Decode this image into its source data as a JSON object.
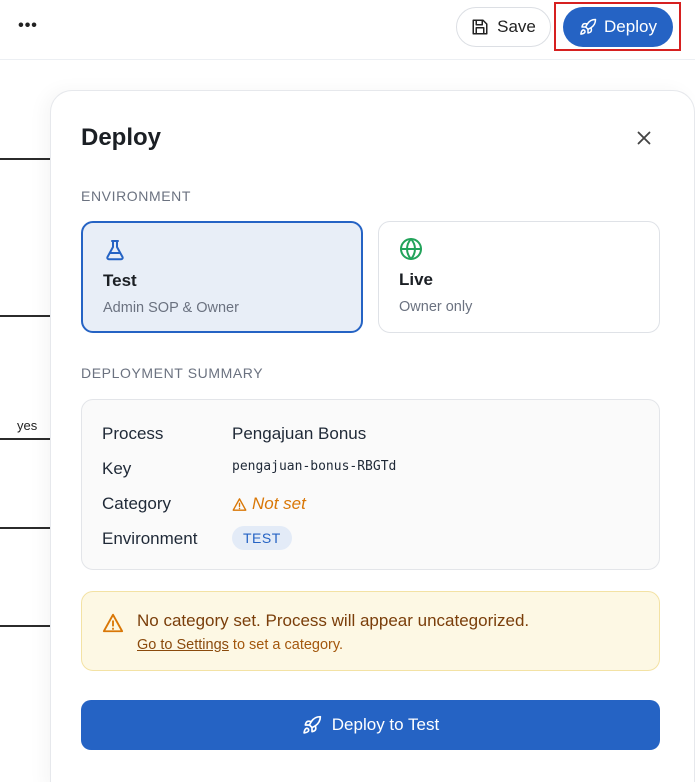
{
  "topbar": {
    "more_label": "•••",
    "save_label": "Save",
    "deploy_label": "Deploy"
  },
  "canvas": {
    "edge_label": "yes"
  },
  "panel": {
    "title": "Deploy",
    "environment_section": "ENVIRONMENT",
    "environments": [
      {
        "name": "Test",
        "description": "Admin SOP & Owner",
        "icon": "flask-icon",
        "selected": true
      },
      {
        "name": "Live",
        "description": "Owner only",
        "icon": "globe-icon",
        "selected": false
      }
    ],
    "summary_section": "DEPLOYMENT SUMMARY",
    "summary": {
      "process_label": "Process",
      "process_value": "Pengajuan Bonus",
      "key_label": "Key",
      "key_value": "pengajuan-bonus-RBGTd",
      "category_label": "Category",
      "category_value": "Not set",
      "environment_label": "Environment",
      "environment_value": "TEST"
    },
    "alert": {
      "title": "No category set. Process will appear uncategorized.",
      "link": "Go to Settings",
      "suffix": " to set a category."
    },
    "deploy_button": "Deploy to Test"
  },
  "colors": {
    "accent": "#2563c4",
    "warning": "#d97706",
    "live_icon": "#22a35a",
    "highlight_border": "#d62020"
  }
}
